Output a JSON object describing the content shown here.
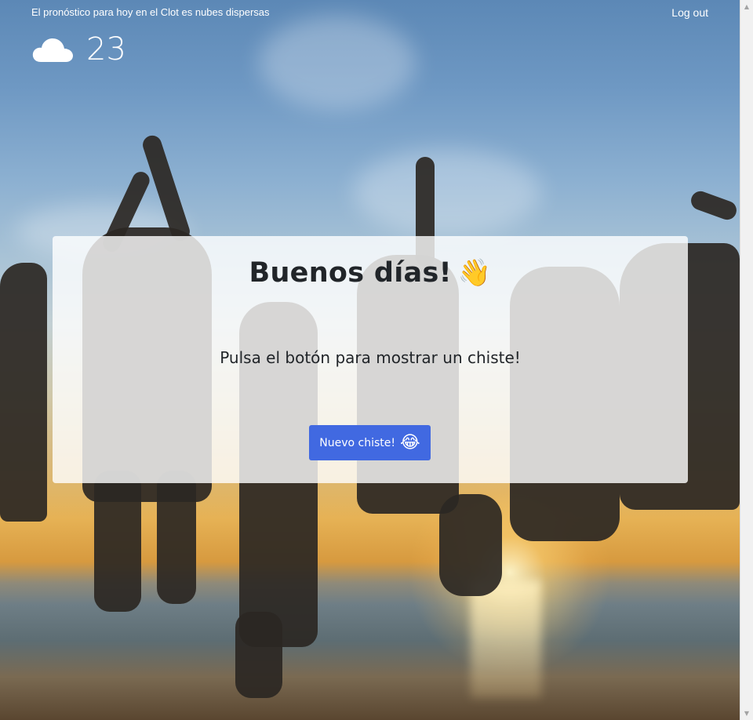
{
  "header": {
    "forecast_text": "El pronóstico para hoy en el Clot es nubes dispersas",
    "logout_label": "Log out"
  },
  "weather": {
    "icon": "cloud-icon",
    "temperature": "23"
  },
  "card": {
    "greeting": "Buenos días!",
    "greeting_emoji": "👋",
    "prompt": "Pulsa el botón para mostrar un chiste!",
    "button_label": "Nuevo chiste!",
    "button_emoji": "😂"
  },
  "colors": {
    "button": "#4169e1",
    "card_background": "rgba(255,255,255,0.80)"
  }
}
